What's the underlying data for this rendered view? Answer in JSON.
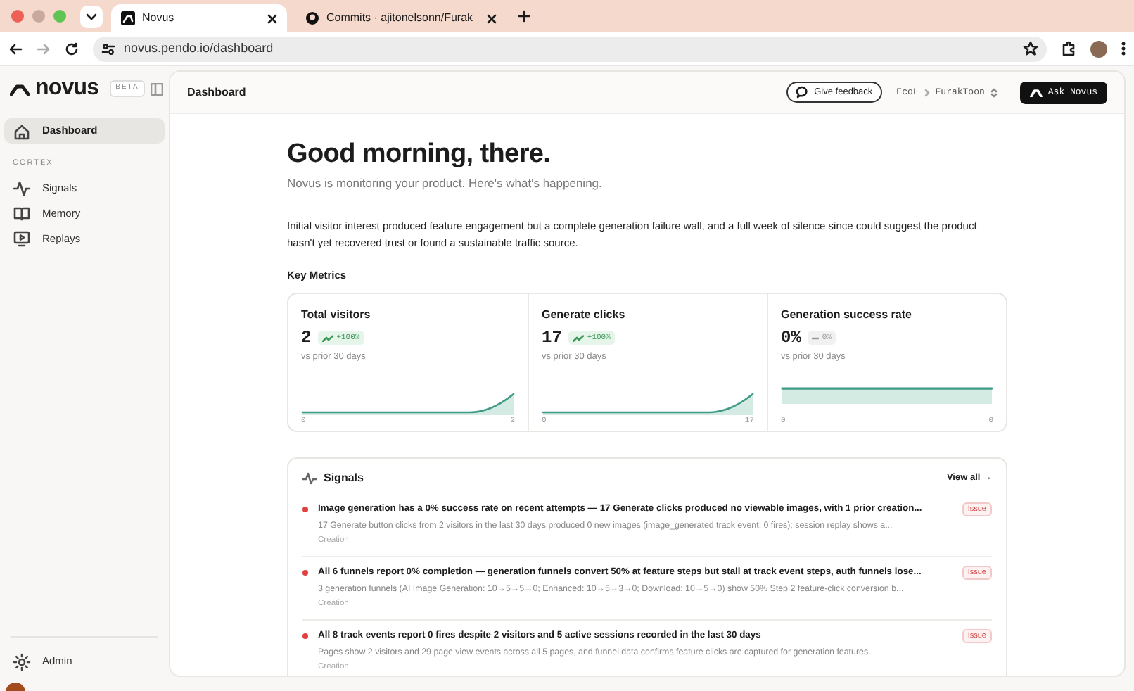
{
  "browser": {
    "tabs": [
      {
        "title": "Novus",
        "selected": true
      },
      {
        "title": "Commits · ajitonelsonn/Furak",
        "selected": false
      }
    ],
    "url": "novus.pendo.io/dashboard"
  },
  "sidebar": {
    "brand": "novus",
    "badge": "BETA",
    "items": [
      {
        "label": "Dashboard",
        "selected": true
      }
    ],
    "section": "CORTEX",
    "section_items": [
      {
        "label": "Signals",
        "selected": false
      },
      {
        "label": "Memory",
        "selected": false
      },
      {
        "label": "Replays",
        "selected": false
      }
    ],
    "footer_item": {
      "label": "Admin",
      "selected": false
    }
  },
  "header": {
    "title": "Dashboard",
    "feedback_button": "Give feedback",
    "breadcrumb": [
      "EcoL",
      "FurakToon"
    ],
    "ask_button": "Ask Novus"
  },
  "greeting": {
    "title": "Good morning, there.",
    "subtitle": "Novus is monitoring your product. Here's what's happening."
  },
  "summary": "Initial visitor interest produced feature engagement but a complete generation failure wall, and a full week of silence since could suggest the product hasn't yet recovered trust or found a sustainable traffic source.",
  "key_metrics": {
    "title": "Key Metrics",
    "cards": [
      {
        "kind": "growth",
        "label": "Total visitors",
        "value": "2",
        "delta": "+100%",
        "comparison": "vs prior 30 days",
        "axis_start": "0",
        "axis_end": "2"
      },
      {
        "kind": "growth",
        "label": "Generate clicks",
        "value": "17",
        "delta": "+100%",
        "comparison": "vs prior 30 days",
        "axis_start": "0",
        "axis_end": "17"
      },
      {
        "kind": "flat",
        "label": "Generation success rate",
        "value": "0%",
        "delta": "0%",
        "comparison": "vs prior 30 days",
        "axis_start": "0",
        "axis_end": "0"
      }
    ]
  },
  "signals": {
    "title": "Signals",
    "view_all": "View all →",
    "items": [
      {
        "title": "Image generation has a 0% success rate on recent attempts — 17 Generate clicks produced no viewable images, with 1 prior creation...",
        "description": "17 Generate button clicks from 2 visitors in the last 30 days produced 0 new images (image_generated track event: 0 fires); session replay shows a...",
        "category": "Creation",
        "badge": "Issue"
      },
      {
        "title": "All 6 funnels report 0% completion — generation funnels convert 50% at feature steps but stall at track event steps, auth funnels lose...",
        "description": "3 generation funnels (AI Image Generation: 10→5→5→0; Enhanced: 10→5→3→0; Download: 10→5→0) show 50% Step 2 feature-click conversion b...",
        "category": "Creation",
        "badge": "Issue"
      },
      {
        "title": "All 8 track events report 0 fires despite 2 visitors and 5 active sessions recorded in the last 30 days",
        "description": "Pages show 2 visitors and 29 page view events across all 5 pages, and funnel data confirms feature clicks are captured for generation features...",
        "category": "Creation",
        "badge": "Issue"
      }
    ]
  }
}
